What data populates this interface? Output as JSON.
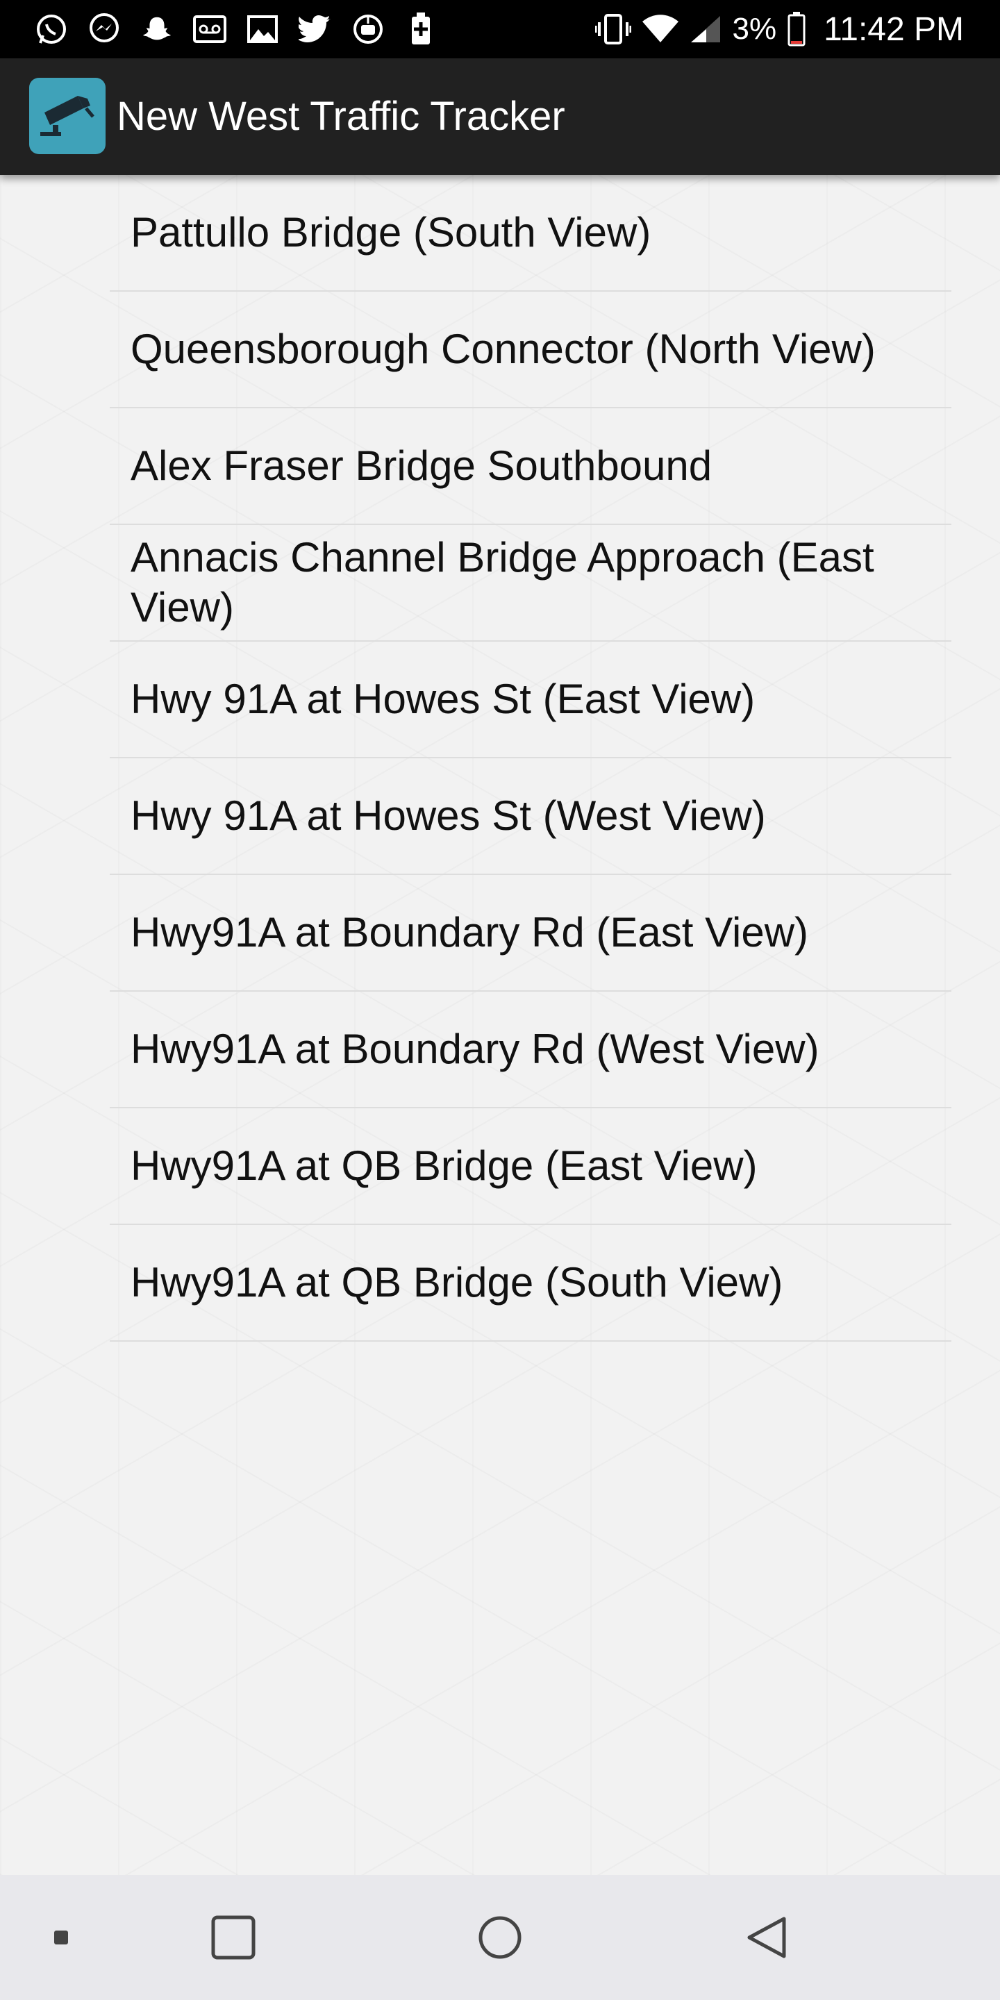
{
  "status_bar": {
    "left_icons": [
      "whatsapp-icon",
      "messenger-icon",
      "snapchat-icon",
      "voicemail-icon",
      "gallery-icon",
      "twitter-icon",
      "android-icon",
      "battery-saver-icon"
    ],
    "right_icons": [
      "vibrate-icon",
      "wifi-icon",
      "signal-icon",
      "battery-icon"
    ],
    "battery_percent": "3%",
    "time": "11:42 PM"
  },
  "app_bar": {
    "title": "New West Traffic Tracker",
    "icon": "traffic-camera-icon",
    "icon_color": "#3fa2b9"
  },
  "camera_list": {
    "items": [
      {
        "label": "Pattullo Bridge (South View)"
      },
      {
        "label": "Queensborough Connector (North View)"
      },
      {
        "label": "Alex Fraser Bridge Southbound"
      },
      {
        "label": "Annacis Channel Bridge Approach (East View)"
      },
      {
        "label": "Hwy 91A at Howes St (East View)"
      },
      {
        "label": "Hwy 91A at Howes St (West View)"
      },
      {
        "label": "Hwy91A at Boundary Rd (East View)"
      },
      {
        "label": "Hwy91A at Boundary Rd (West View)"
      },
      {
        "label": "Hwy91A at QB Bridge (East View)"
      },
      {
        "label": "Hwy91A at QB Bridge (South View)"
      }
    ]
  },
  "nav_bar": {
    "buttons": [
      "menu-dot-icon",
      "recents-square-icon",
      "home-circle-icon",
      "back-triangle-icon"
    ]
  }
}
